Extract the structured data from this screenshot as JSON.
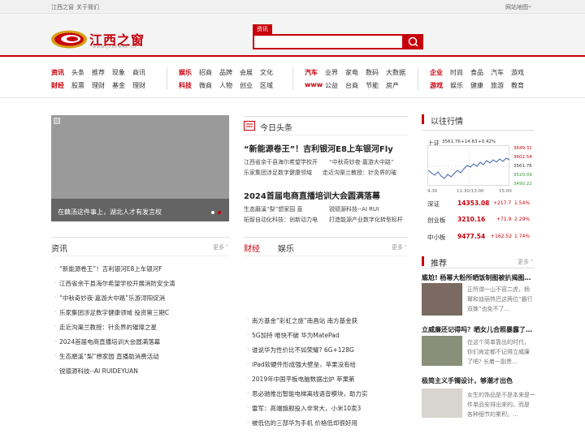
{
  "topbar": {
    "left1": "江西之窗",
    "left2": "关于我们",
    "right": "网站地图"
  },
  "logo": {
    "text": "江西之窗",
    "url": "www.jxzcwxs.cn"
  },
  "search": {
    "tab": "资讯",
    "placeholder": ""
  },
  "nav": {
    "g1": {
      "r1": [
        "资讯",
        "头条",
        "推荐",
        "现象",
        "商讯"
      ],
      "r2": [
        "财经",
        "股票",
        "理财",
        "基金",
        "理财"
      ]
    },
    "g2": {
      "r1": [
        "娱乐",
        "招商",
        "品牌",
        "会展",
        "文化"
      ],
      "r2": [
        "科技",
        "微商",
        "人物",
        "创业",
        "区域"
      ]
    },
    "g3": {
      "r1": [
        "汽车",
        "业界",
        "家电",
        "数码",
        "大数据"
      ],
      "r2": [
        "www",
        "公益",
        "台商",
        "节能",
        "房产"
      ]
    },
    "g4": {
      "r1": [
        "企业",
        "时尚",
        "食品",
        "汽车",
        "游戏"
      ],
      "r2": [
        "游戏",
        "娱乐",
        "健康",
        "旅游",
        "教育"
      ]
    }
  },
  "slide": {
    "caption": "在藕汤这件事上，湖北人才有发言权"
  },
  "toutiao": {
    "title": "今日头条",
    "h1": "“新能源卷王”！吉利银河E8上车银河Fly",
    "h1a": "江西省余干县海尔希望学校开",
    "h1b": "“中秋奇妙夜·嘉游大中路”",
    "h1c": "乐家集团涉足数字健康领域",
    "h1d": "走近沟渠兰教授：针灸界的璀",
    "h2": "2024首届电商直播培训大会圆满落幕",
    "h2a": "生态磨溪“梨”想家园 直",
    "h2b": "锐德源科技--AI RUI",
    "h2c": "拓智自动化科技：创新动力电",
    "h2d": "打造能源产业数字化转型标杆"
  },
  "zixun": {
    "title": "资讯",
    "more": "更多",
    "items": [
      "“新能源卷王”！吉利银河E8上车银河F",
      "江西省余干县海尔希望学校开展消防安全演",
      "“中秋奇妙夜·嘉游大中路”乐游浔阳促消",
      "乐家集团涉足数字健康领域 投资第三期C",
      "走近沟渠兰教授：针灸界的璀璨之星",
      "2024首届电商直播培训大会圆满落幕",
      "生态磨溪“梨”想家园 直播助消费活动",
      "锐德源科技--AI RUIDEYUAN"
    ]
  },
  "caijing": {
    "tab1": "财经",
    "tab2": "娱乐",
    "more": "更多",
    "items": [
      "南方基金“彩虹之旅”南昌站 南方基金获",
      "5G加持 唯快不破 华为MatePad",
      "谁说华为性价比不如荣耀? 6G+128G",
      "iPad软硬件形成强大壁垒，苹果没有给",
      "2019年中国平板电脑数据出炉 苹果第",
      "思必驰推出智能电梯离线语音模块，助力实",
      "雷军：高端旗舰投入非常大，小米10卖3",
      "被低估的三部华为手机 价格低却很好用"
    ]
  },
  "market": {
    "title": "以往行情",
    "index": "上证",
    "price": "3561.76",
    "chg": "+14.83",
    "pct": "+0.42%",
    "axis": [
      "3649.31",
      "3602.54",
      "3561.76",
      "3520.09",
      "3490.22"
    ],
    "times": [
      "9:30",
      "11:30/13:00",
      "15:00"
    ],
    "rows": [
      {
        "name": "深证",
        "v": "14353.08",
        "c": "+217.7",
        "p": "1.54%"
      },
      {
        "name": "创业板",
        "v": "3210.16",
        "c": "+71.9",
        "p": "2.29%"
      },
      {
        "name": "中小板",
        "v": "9477.54",
        "c": "+162.52",
        "p": "1.74%"
      }
    ]
  },
  "recommend": {
    "title": "推荐",
    "more": "更多",
    "items": [
      {
        "title": "尴尬! 杨幂大粉所晒饭制图被扒揭图…",
        "desc": [
          "正所谓一山不容二虎，杨",
          "幂和迪丽热巴这两位“霸行",
          "双姝”也免不了…"
        ]
      },
      {
        "title": "立威廉还记得吗？晒女儿合照暴露了…",
        "desc": [
          "在这个简单靠出的时代，",
          "你们肯定都不记得立威廉",
          "了吧? 长着一副贵…"
        ]
      },
      {
        "title": "极简主义手镯设计，够潮才出色",
        "desc": [
          "女生的饰品是不是本来是一",
          "件单品安排出来的。而是",
          "各种细节的累积。…"
        ]
      }
    ]
  }
}
